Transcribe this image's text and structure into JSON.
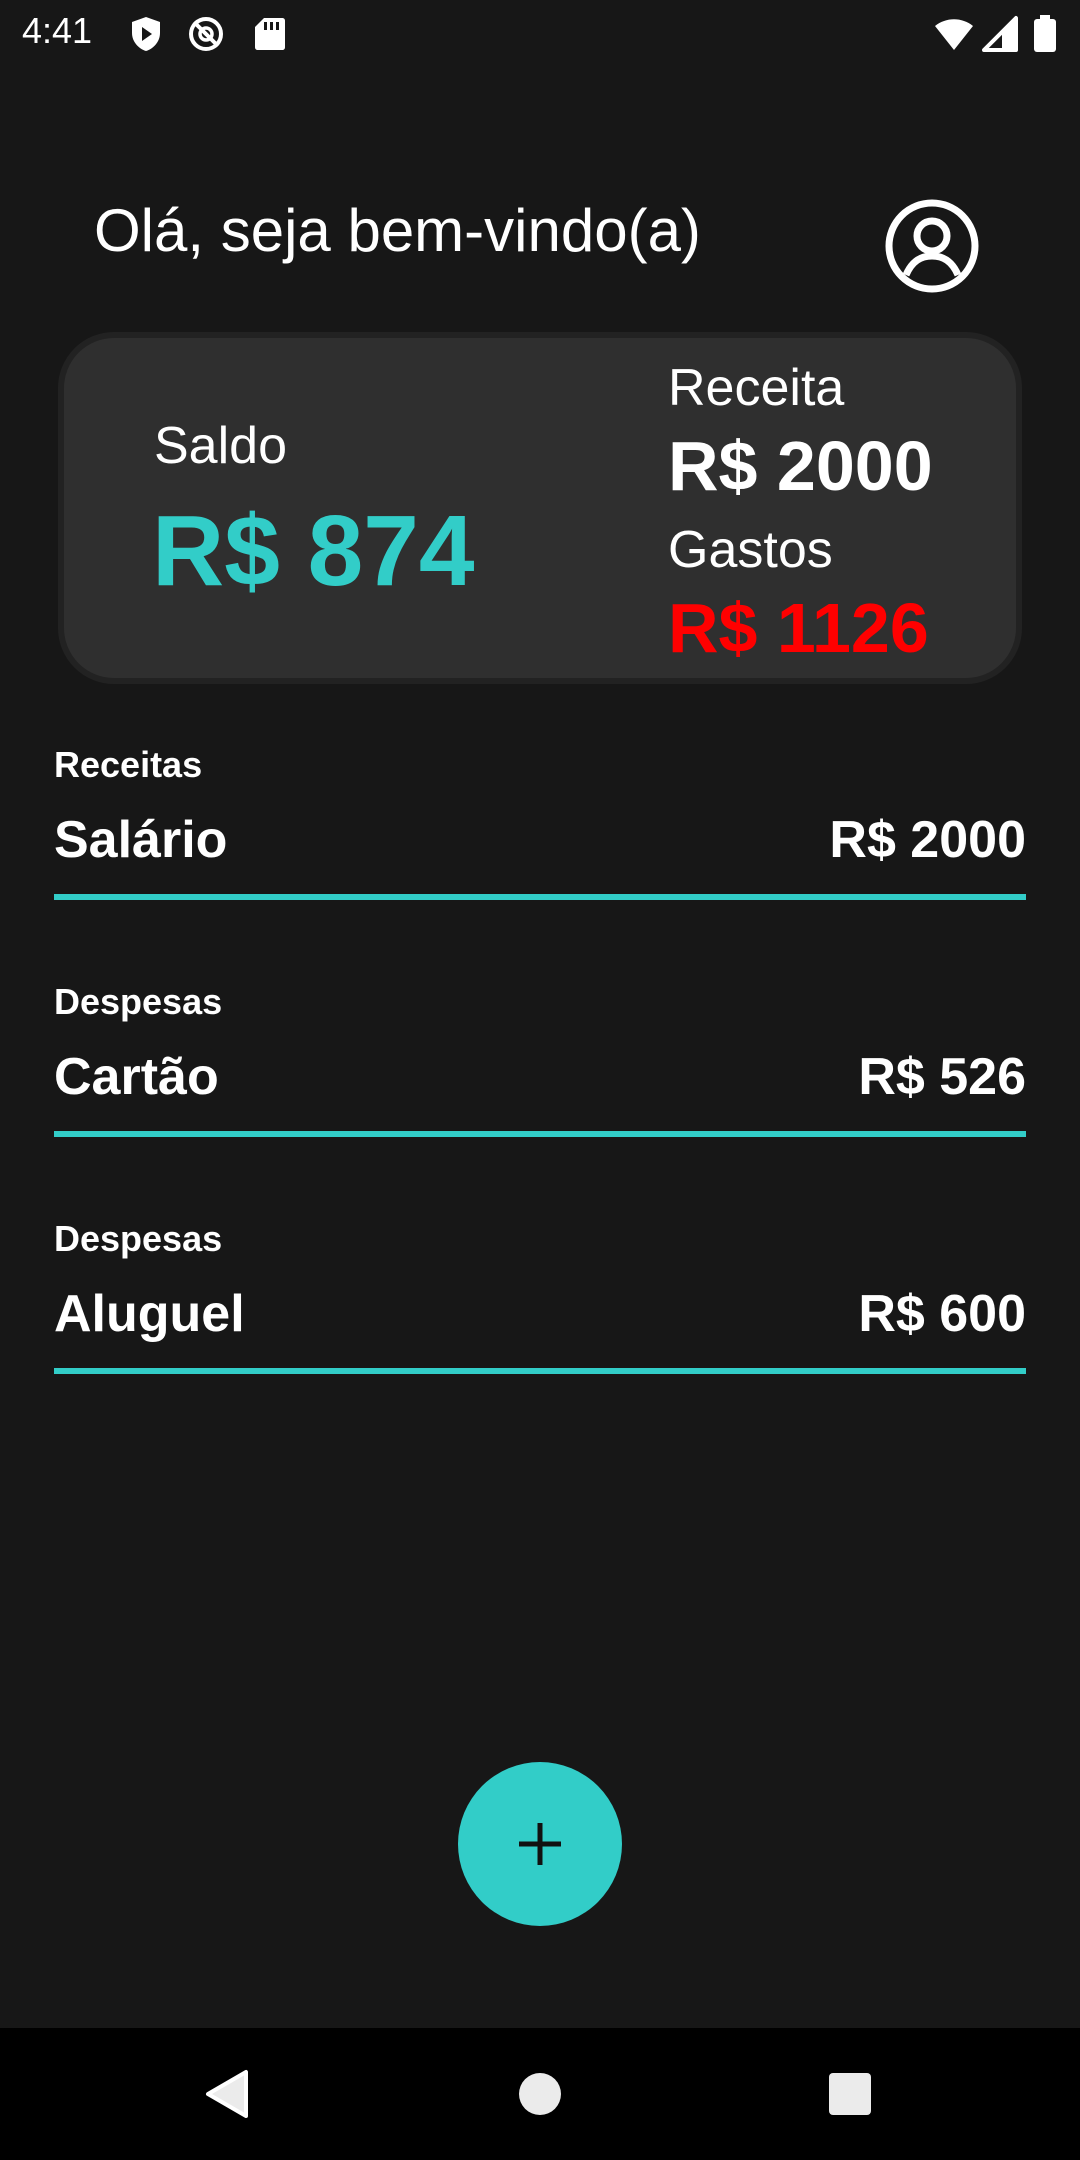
{
  "status_bar": {
    "time": "4:41",
    "icons": [
      "shield-play-icon",
      "no-tracking-icon",
      "sd-card-icon",
      "wifi-icon",
      "cell-signal-icon",
      "battery-icon"
    ]
  },
  "header": {
    "greeting": "Olá, seja bem-vindo(a)",
    "account_icon": "account-circle-icon"
  },
  "summary": {
    "balance_label": "Saldo",
    "balance_value": "R$ 874",
    "income_label": "Receita",
    "income_value": "R$ 2000",
    "expense_label": "Gastos",
    "expense_value": "R$ 1126"
  },
  "transactions": [
    {
      "category": "Receitas",
      "name": "Salário",
      "amount": "R$ 2000"
    },
    {
      "category": "Despesas",
      "name": "Cartão",
      "amount": "R$ 526"
    },
    {
      "category": "Despesas",
      "name": "Aluguel",
      "amount": "R$ 600"
    }
  ],
  "fab": {
    "icon": "plus-icon"
  },
  "nav_bar": {
    "icons": [
      "back-icon",
      "home-icon",
      "recents-icon"
    ]
  },
  "colors": {
    "background": "#171717",
    "card": "#2f2f2f",
    "accent": "#32cdc8",
    "expense": "#ff0000"
  }
}
